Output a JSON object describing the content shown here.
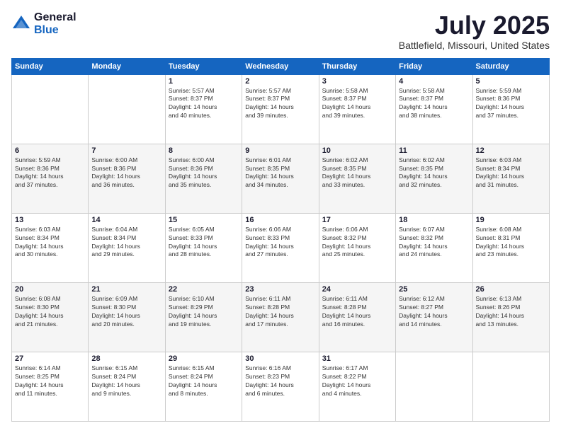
{
  "logo": {
    "general": "General",
    "blue": "Blue"
  },
  "header": {
    "month": "July 2025",
    "location": "Battlefield, Missouri, United States"
  },
  "weekdays": [
    "Sunday",
    "Monday",
    "Tuesday",
    "Wednesday",
    "Thursday",
    "Friday",
    "Saturday"
  ],
  "weeks": [
    [
      {
        "day": "",
        "info": ""
      },
      {
        "day": "",
        "info": ""
      },
      {
        "day": "1",
        "info": "Sunrise: 5:57 AM\nSunset: 8:37 PM\nDaylight: 14 hours\nand 40 minutes."
      },
      {
        "day": "2",
        "info": "Sunrise: 5:57 AM\nSunset: 8:37 PM\nDaylight: 14 hours\nand 39 minutes."
      },
      {
        "day": "3",
        "info": "Sunrise: 5:58 AM\nSunset: 8:37 PM\nDaylight: 14 hours\nand 39 minutes."
      },
      {
        "day": "4",
        "info": "Sunrise: 5:58 AM\nSunset: 8:37 PM\nDaylight: 14 hours\nand 38 minutes."
      },
      {
        "day": "5",
        "info": "Sunrise: 5:59 AM\nSunset: 8:36 PM\nDaylight: 14 hours\nand 37 minutes."
      }
    ],
    [
      {
        "day": "6",
        "info": "Sunrise: 5:59 AM\nSunset: 8:36 PM\nDaylight: 14 hours\nand 37 minutes."
      },
      {
        "day": "7",
        "info": "Sunrise: 6:00 AM\nSunset: 8:36 PM\nDaylight: 14 hours\nand 36 minutes."
      },
      {
        "day": "8",
        "info": "Sunrise: 6:00 AM\nSunset: 8:36 PM\nDaylight: 14 hours\nand 35 minutes."
      },
      {
        "day": "9",
        "info": "Sunrise: 6:01 AM\nSunset: 8:35 PM\nDaylight: 14 hours\nand 34 minutes."
      },
      {
        "day": "10",
        "info": "Sunrise: 6:02 AM\nSunset: 8:35 PM\nDaylight: 14 hours\nand 33 minutes."
      },
      {
        "day": "11",
        "info": "Sunrise: 6:02 AM\nSunset: 8:35 PM\nDaylight: 14 hours\nand 32 minutes."
      },
      {
        "day": "12",
        "info": "Sunrise: 6:03 AM\nSunset: 8:34 PM\nDaylight: 14 hours\nand 31 minutes."
      }
    ],
    [
      {
        "day": "13",
        "info": "Sunrise: 6:03 AM\nSunset: 8:34 PM\nDaylight: 14 hours\nand 30 minutes."
      },
      {
        "day": "14",
        "info": "Sunrise: 6:04 AM\nSunset: 8:34 PM\nDaylight: 14 hours\nand 29 minutes."
      },
      {
        "day": "15",
        "info": "Sunrise: 6:05 AM\nSunset: 8:33 PM\nDaylight: 14 hours\nand 28 minutes."
      },
      {
        "day": "16",
        "info": "Sunrise: 6:06 AM\nSunset: 8:33 PM\nDaylight: 14 hours\nand 27 minutes."
      },
      {
        "day": "17",
        "info": "Sunrise: 6:06 AM\nSunset: 8:32 PM\nDaylight: 14 hours\nand 25 minutes."
      },
      {
        "day": "18",
        "info": "Sunrise: 6:07 AM\nSunset: 8:32 PM\nDaylight: 14 hours\nand 24 minutes."
      },
      {
        "day": "19",
        "info": "Sunrise: 6:08 AM\nSunset: 8:31 PM\nDaylight: 14 hours\nand 23 minutes."
      }
    ],
    [
      {
        "day": "20",
        "info": "Sunrise: 6:08 AM\nSunset: 8:30 PM\nDaylight: 14 hours\nand 21 minutes."
      },
      {
        "day": "21",
        "info": "Sunrise: 6:09 AM\nSunset: 8:30 PM\nDaylight: 14 hours\nand 20 minutes."
      },
      {
        "day": "22",
        "info": "Sunrise: 6:10 AM\nSunset: 8:29 PM\nDaylight: 14 hours\nand 19 minutes."
      },
      {
        "day": "23",
        "info": "Sunrise: 6:11 AM\nSunset: 8:28 PM\nDaylight: 14 hours\nand 17 minutes."
      },
      {
        "day": "24",
        "info": "Sunrise: 6:11 AM\nSunset: 8:28 PM\nDaylight: 14 hours\nand 16 minutes."
      },
      {
        "day": "25",
        "info": "Sunrise: 6:12 AM\nSunset: 8:27 PM\nDaylight: 14 hours\nand 14 minutes."
      },
      {
        "day": "26",
        "info": "Sunrise: 6:13 AM\nSunset: 8:26 PM\nDaylight: 14 hours\nand 13 minutes."
      }
    ],
    [
      {
        "day": "27",
        "info": "Sunrise: 6:14 AM\nSunset: 8:25 PM\nDaylight: 14 hours\nand 11 minutes."
      },
      {
        "day": "28",
        "info": "Sunrise: 6:15 AM\nSunset: 8:24 PM\nDaylight: 14 hours\nand 9 minutes."
      },
      {
        "day": "29",
        "info": "Sunrise: 6:15 AM\nSunset: 8:24 PM\nDaylight: 14 hours\nand 8 minutes."
      },
      {
        "day": "30",
        "info": "Sunrise: 6:16 AM\nSunset: 8:23 PM\nDaylight: 14 hours\nand 6 minutes."
      },
      {
        "day": "31",
        "info": "Sunrise: 6:17 AM\nSunset: 8:22 PM\nDaylight: 14 hours\nand 4 minutes."
      },
      {
        "day": "",
        "info": ""
      },
      {
        "day": "",
        "info": ""
      }
    ]
  ]
}
